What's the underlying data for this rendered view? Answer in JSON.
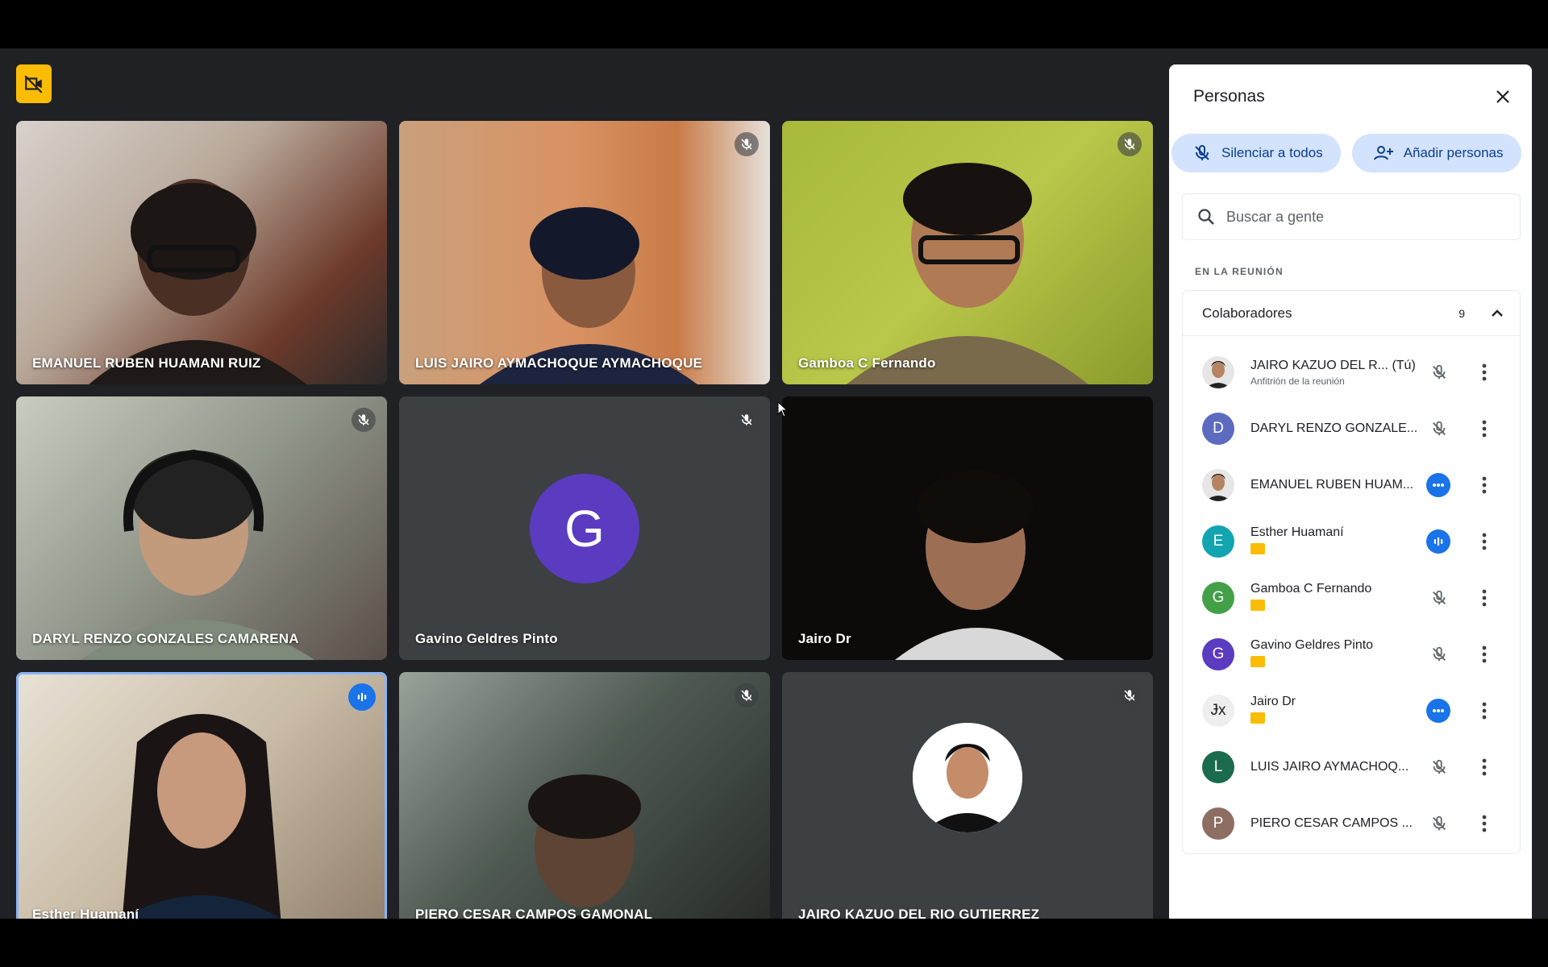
{
  "colors": {
    "stage_bg": "#202124",
    "tile_bg": "#3c4043",
    "accent_blue": "#1a73e8",
    "pill_bg": "#d3e3fd",
    "badge_yellow": "#fbbc04"
  },
  "top_badge": {
    "icon": "camera-off-icon"
  },
  "tiles": [
    {
      "name": "EMANUEL RUBEN HUAMANI RUIZ",
      "status": "none"
    },
    {
      "name": "LUIS JAIRO AYMACHOQUE AYMACHOQUE",
      "status": "mic-off"
    },
    {
      "name": "Gamboa C Fernando",
      "status": "mic-off"
    },
    {
      "name": "DARYL RENZO GONZALES CAMARENA",
      "status": "mic-off"
    },
    {
      "name": "Gavino Geldres Pinto",
      "status": "mic-off",
      "avatar_letter": "G",
      "avatar_color": "#5b3bc0"
    },
    {
      "name": "Jairo Dr",
      "status": "none"
    },
    {
      "name": "Esther Huamaní",
      "status": "speaking",
      "active": true
    },
    {
      "name": "PIERO CESAR CAMPOS GAMONAL",
      "status": "mic-off"
    },
    {
      "name": "JAIRO KAZUO DEL RIO GUTIERREZ",
      "status": "mic-off"
    }
  ],
  "panel": {
    "title": "Personas",
    "mute_all_label": "Silenciar a todos",
    "add_people_label": "Añadir personas",
    "search_placeholder": "Buscar a gente",
    "section_label": "EN LA REUNIÓN",
    "group": {
      "label": "Colaboradores",
      "count": "9"
    },
    "people": [
      {
        "name": "JAIRO KAZUO DEL R... (Tú)",
        "sub": "Anfitrión de la reunión",
        "avatar_type": "photo",
        "status": "mic-off"
      },
      {
        "name": "DARYL RENZO GONZALE...",
        "sub": "",
        "avatar_letter": "D",
        "avatar_color": "#5c6bc0",
        "status": "mic-off"
      },
      {
        "name": "EMANUEL RUBEN HUAM...",
        "sub": "",
        "avatar_type": "photo",
        "status": "dots-blue"
      },
      {
        "name": "Esther Huamaní",
        "sub": "",
        "badge": true,
        "avatar_letter": "E",
        "avatar_color": "#12a4af",
        "status": "wave-blue"
      },
      {
        "name": "Gamboa C Fernando",
        "sub": "",
        "badge": true,
        "avatar_letter": "G",
        "avatar_color": "#43a047",
        "status": "mic-off"
      },
      {
        "name": "Gavino Geldres Pinto",
        "sub": "",
        "badge": true,
        "avatar_letter": "G",
        "avatar_color": "#5b3bc0",
        "status": "mic-off"
      },
      {
        "name": "Jairo Dr",
        "sub": "",
        "badge": true,
        "avatar_letter": "Ɉx",
        "avatar_color": "#eeeeee",
        "status": "dots-blue"
      },
      {
        "name": "LUIS JAIRO AYMACHOQ...",
        "sub": "",
        "avatar_letter": "L",
        "avatar_color": "#1b6b4f",
        "status": "mic-off"
      },
      {
        "name": "PIERO CESAR CAMPOS ...",
        "sub": "",
        "avatar_letter": "P",
        "avatar_color": "#8d6e63",
        "status": "mic-off"
      }
    ]
  }
}
